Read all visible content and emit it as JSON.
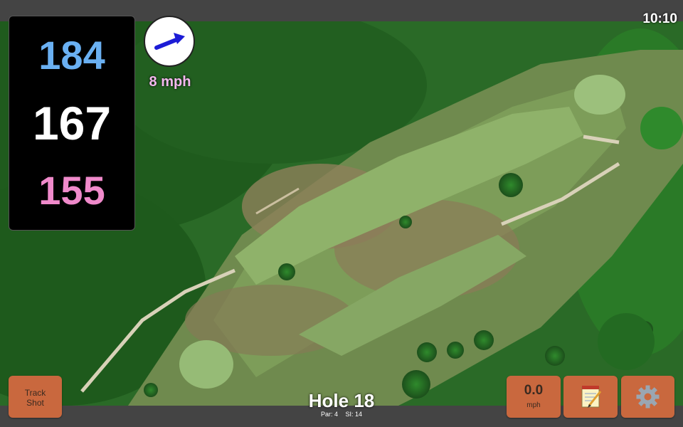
{
  "status": {
    "time": "10:10"
  },
  "distances": {
    "back": "184",
    "middle": "167",
    "front": "155"
  },
  "wind": {
    "speed": "8 mph",
    "direction_icon": "arrow-icon",
    "arrow_color": "#1c1cd6"
  },
  "hole": {
    "title": "Hole 18",
    "par": "Par: 4",
    "stroke_index": "SI: 14"
  },
  "buttons": {
    "track_shot_line1": "Track",
    "track_shot_line2": "Shot",
    "speed_value": "0.0",
    "speed_unit": "mph",
    "notes_icon": "notepad-icon",
    "settings_icon": "gear-icon"
  },
  "colors": {
    "button": "#c9683e",
    "back_distance": "#6ab0f2",
    "middle_distance": "#ffffff",
    "front_distance": "#f08acb",
    "wind_text": "#f3b8ee"
  }
}
